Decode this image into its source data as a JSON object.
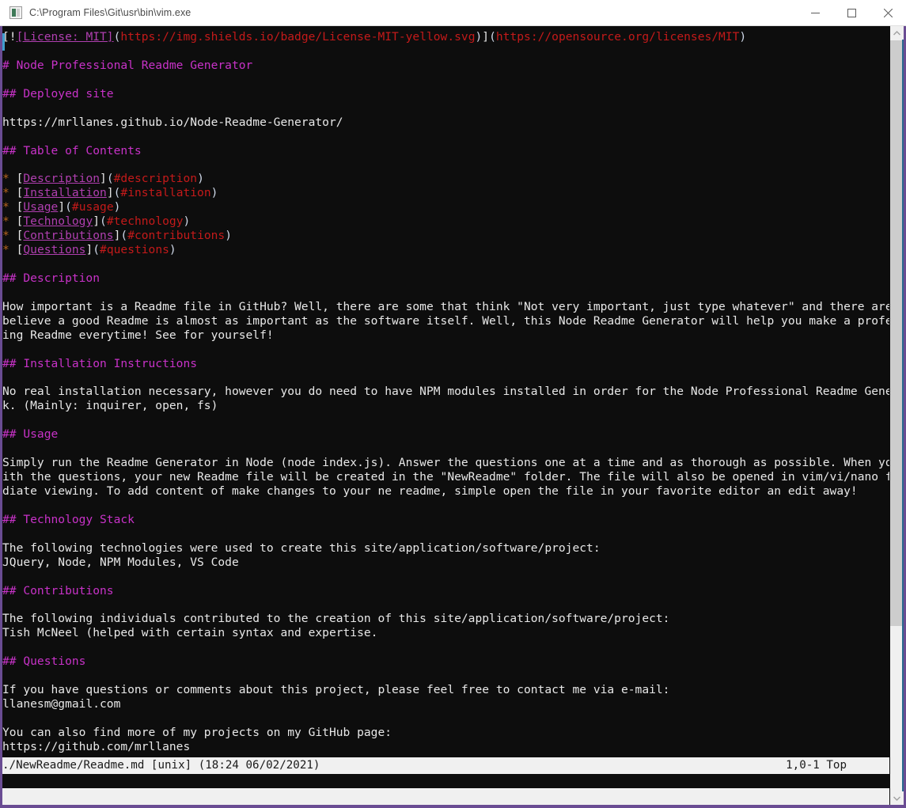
{
  "window": {
    "title": "C:\\Program Files\\Git\\usr\\bin\\vim.exe",
    "icon": "terminal-icon",
    "controls": {
      "minimize": "minimize-icon",
      "maximize": "maximize-icon",
      "close": "close-icon"
    },
    "border_color": "#6a4c93"
  },
  "colors": {
    "background": "#0d0d0d",
    "text": "#e8e8e8",
    "heading": "#c832c8",
    "link": "#b03fb0",
    "url": "#c41a1a",
    "paren": "#cfd8e8",
    "bullet": "#b5651d",
    "statusline_bg": "#f0f0f0",
    "statusline_fg": "#1a1a1a"
  },
  "editor": {
    "lines": [
      {
        "segments": [
          {
            "text": "[!",
            "style": "text"
          },
          {
            "text": "[License: MIT]",
            "style": "link"
          },
          {
            "text": "(",
            "style": "paren"
          },
          {
            "text": "https://img.shields.io/badge/License-MIT-yellow.svg",
            "style": "url"
          },
          {
            "text": ")",
            "style": "paren"
          },
          {
            "text": "]",
            "style": "text"
          },
          {
            "text": "(",
            "style": "paren"
          },
          {
            "text": "https://opensource.org/licenses/MIT",
            "style": "url"
          },
          {
            "text": ")",
            "style": "paren"
          }
        ]
      },
      {
        "segments": []
      },
      {
        "segments": [
          {
            "text": "# Node Professional Readme Generator",
            "style": "head"
          }
        ]
      },
      {
        "segments": []
      },
      {
        "segments": [
          {
            "text": "## Deployed site",
            "style": "head"
          }
        ]
      },
      {
        "segments": []
      },
      {
        "segments": [
          {
            "text": "https://mrllanes.github.io/Node-Readme-Generator/",
            "style": "text"
          }
        ]
      },
      {
        "segments": []
      },
      {
        "segments": [
          {
            "text": "## Table of Contents",
            "style": "head"
          }
        ]
      },
      {
        "segments": []
      },
      {
        "segments": [
          {
            "text": "*",
            "style": "bullet"
          },
          {
            "text": " [",
            "style": "text"
          },
          {
            "text": "Description",
            "style": "link"
          },
          {
            "text": "]",
            "style": "text"
          },
          {
            "text": "(",
            "style": "paren"
          },
          {
            "text": "#description",
            "style": "url"
          },
          {
            "text": ")",
            "style": "paren"
          }
        ]
      },
      {
        "segments": [
          {
            "text": "*",
            "style": "bullet"
          },
          {
            "text": " [",
            "style": "text"
          },
          {
            "text": "Installation",
            "style": "link"
          },
          {
            "text": "]",
            "style": "text"
          },
          {
            "text": "(",
            "style": "paren"
          },
          {
            "text": "#installation",
            "style": "url"
          },
          {
            "text": ")",
            "style": "paren"
          }
        ]
      },
      {
        "segments": [
          {
            "text": "*",
            "style": "bullet"
          },
          {
            "text": " [",
            "style": "text"
          },
          {
            "text": "Usage",
            "style": "link"
          },
          {
            "text": "]",
            "style": "text"
          },
          {
            "text": "(",
            "style": "paren"
          },
          {
            "text": "#usage",
            "style": "url"
          },
          {
            "text": ")",
            "style": "paren"
          }
        ]
      },
      {
        "segments": [
          {
            "text": "*",
            "style": "bullet"
          },
          {
            "text": " [",
            "style": "text"
          },
          {
            "text": "Technology",
            "style": "link"
          },
          {
            "text": "]",
            "style": "text"
          },
          {
            "text": "(",
            "style": "paren"
          },
          {
            "text": "#technology",
            "style": "url"
          },
          {
            "text": ")",
            "style": "paren"
          }
        ]
      },
      {
        "segments": [
          {
            "text": "*",
            "style": "bullet"
          },
          {
            "text": " [",
            "style": "text"
          },
          {
            "text": "Contributions",
            "style": "link"
          },
          {
            "text": "]",
            "style": "text"
          },
          {
            "text": "(",
            "style": "paren"
          },
          {
            "text": "#contributions",
            "style": "url"
          },
          {
            "text": ")",
            "style": "paren"
          }
        ]
      },
      {
        "segments": [
          {
            "text": "*",
            "style": "bullet"
          },
          {
            "text": " [",
            "style": "text"
          },
          {
            "text": "Questions",
            "style": "link"
          },
          {
            "text": "]",
            "style": "text"
          },
          {
            "text": "(",
            "style": "paren"
          },
          {
            "text": "#questions",
            "style": "url"
          },
          {
            "text": ")",
            "style": "paren"
          }
        ]
      },
      {
        "segments": []
      },
      {
        "segments": [
          {
            "text": "## Description",
            "style": "head"
          }
        ]
      },
      {
        "segments": []
      },
      {
        "segments": [
          {
            "text": "How important is a Readme file in GitHub? Well, there are some that think \"Not very important, just type whatever\" and there are others who",
            "style": "text"
          }
        ]
      },
      {
        "segments": [
          {
            "text": "believe a good Readme is almost as important as the software itself. Well, this Node Readme Generator will help you make a professional look",
            "style": "text"
          }
        ]
      },
      {
        "segments": [
          {
            "text": "ing Readme everytime! See for yourself!",
            "style": "text"
          }
        ]
      },
      {
        "segments": []
      },
      {
        "segments": [
          {
            "text": "## Installation Instructions",
            "style": "head"
          }
        ]
      },
      {
        "segments": []
      },
      {
        "segments": [
          {
            "text": "No real installation necessary, however you do need to have NPM modules installed in order for the Node Professional Readme Generator to wor",
            "style": "text"
          }
        ]
      },
      {
        "segments": [
          {
            "text": "k. (Mainly: inquirer, open, fs)",
            "style": "text"
          }
        ]
      },
      {
        "segments": []
      },
      {
        "segments": [
          {
            "text": "## Usage",
            "style": "head"
          }
        ]
      },
      {
        "segments": []
      },
      {
        "segments": [
          {
            "text": "Simply run the Readme Generator in Node (node index.js). Answer the questions one at a time and as thorough as possible. When you are done w",
            "style": "text"
          }
        ]
      },
      {
        "segments": [
          {
            "text": "ith the questions, your new Readme file will be created in the \"NewReadme\" folder. The file will also be opened in vim/vi/nano for your imme",
            "style": "text"
          }
        ]
      },
      {
        "segments": [
          {
            "text": "diate viewing. To add content of make changes to your ne readme, simple open the file in your favorite editor an edit away!",
            "style": "text"
          }
        ]
      },
      {
        "segments": []
      },
      {
        "segments": [
          {
            "text": "## Technology Stack",
            "style": "head"
          }
        ]
      },
      {
        "segments": []
      },
      {
        "segments": [
          {
            "text": "The following technologies were used to create this site/application/software/project:",
            "style": "text"
          }
        ]
      },
      {
        "segments": [
          {
            "text": "JQuery, Node, NPM Modules, VS Code",
            "style": "text"
          }
        ]
      },
      {
        "segments": []
      },
      {
        "segments": [
          {
            "text": "## Contributions",
            "style": "head"
          }
        ]
      },
      {
        "segments": []
      },
      {
        "segments": [
          {
            "text": "The following individuals contributed to the creation of this site/application/software/project:",
            "style": "text"
          }
        ]
      },
      {
        "segments": [
          {
            "text": "Tish McNeel (helped with certain syntax and expertise.",
            "style": "text"
          }
        ]
      },
      {
        "segments": []
      },
      {
        "segments": [
          {
            "text": "## Questions",
            "style": "head"
          }
        ]
      },
      {
        "segments": []
      },
      {
        "segments": [
          {
            "text": "If you have questions or comments about this project, please feel free to contact me via e-mail:",
            "style": "text"
          }
        ]
      },
      {
        "segments": [
          {
            "text": "llanesm@gmail.com",
            "style": "text"
          }
        ]
      },
      {
        "segments": []
      },
      {
        "segments": [
          {
            "text": "You can also find more of my projects on my GitHub page:",
            "style": "text"
          }
        ]
      },
      {
        "segments": [
          {
            "text": "https://github.com/mrllanes",
            "style": "text"
          }
        ]
      }
    ]
  },
  "statusline": {
    "file_info": "./NewReadme/Readme.md [unix] (18:24 06/02/2021)",
    "position": "1,0-1 Top"
  },
  "scrollbar": {
    "up_arrow": "chevron-up-icon",
    "down_arrow": "chevron-down-icon"
  }
}
